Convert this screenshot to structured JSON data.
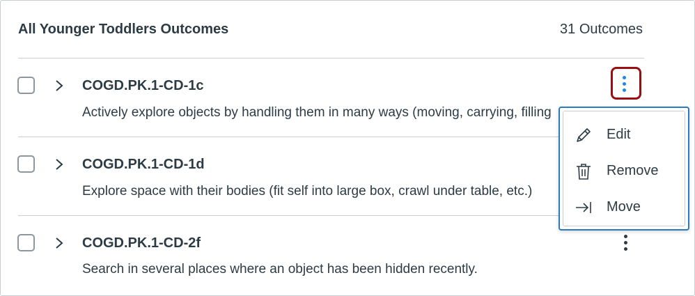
{
  "group": {
    "title": "All Younger Toddlers Outcomes",
    "count_label": "31 Outcomes"
  },
  "outcomes": [
    {
      "code": "COGD.PK.1-CD-1c",
      "description": "Actively explore objects by handling them in many ways (moving, carrying, filling"
    },
    {
      "code": "COGD.PK.1-CD-1d",
      "description": "Explore space with their bodies (fit self into large box, crawl under table, etc.)"
    },
    {
      "code": "COGD.PK.1-CD-2f",
      "description": "Search in several places where an object has been hidden recently."
    }
  ],
  "menu": {
    "items": [
      {
        "label": "Edit",
        "icon": "pencil-icon"
      },
      {
        "label": "Remove",
        "icon": "trash-icon"
      },
      {
        "label": "Move",
        "icon": "move-arrow-icon"
      }
    ]
  },
  "colors": {
    "text": "#2d3b45",
    "divider": "#c7cdd1",
    "kebab_focus_ring": "#9b0d11",
    "kebab_active_dots": "#1e88e5",
    "menu_border": "#2b7abc"
  }
}
